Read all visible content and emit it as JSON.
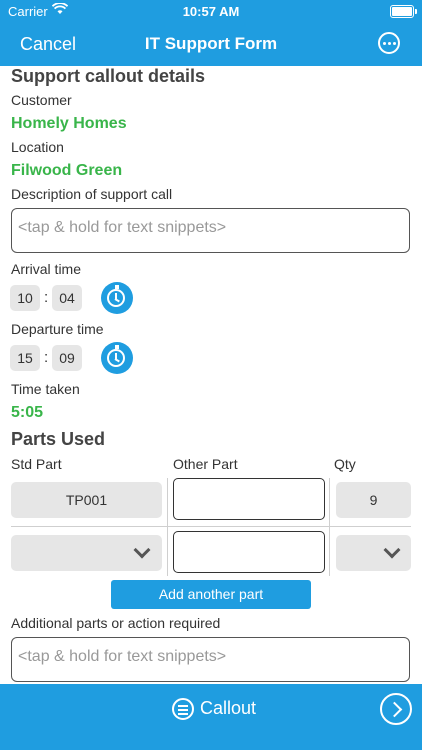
{
  "status_bar": {
    "carrier": "Carrier",
    "time": "10:57 AM"
  },
  "nav": {
    "cancel_label": "Cancel",
    "title": "IT Support Form",
    "more_icon": "more-circle-icon"
  },
  "callout_details": {
    "section_title": "Support callout details",
    "customer_label": "Customer",
    "customer_value": "Homely Homes",
    "location_label": "Location",
    "location_value": "Filwood Green",
    "description_label": "Description of support call",
    "description_placeholder": "<tap & hold for text snippets>"
  },
  "times": {
    "arrival_label": "Arrival time",
    "arrival_hour": "10",
    "arrival_minute": "04",
    "departure_label": "Departure time",
    "departure_hour": "15",
    "departure_minute": "09",
    "separator": ":",
    "taken_label": "Time taken",
    "taken_value": "5:05"
  },
  "parts": {
    "section_title": "Parts Used",
    "col_std": "Std Part",
    "col_other": "Other Part",
    "col_qty": "Qty",
    "rows": [
      {
        "std_part": "TP001",
        "other_part": "",
        "qty": "9"
      },
      {
        "std_part": "",
        "other_part": "",
        "qty": ""
      }
    ],
    "add_button": "Add another part"
  },
  "additional": {
    "label": "Additional parts or action required",
    "placeholder": "<tap & hold for text snippets>"
  },
  "bottom_bar": {
    "callout_label": "Callout"
  },
  "colors": {
    "accent": "#1f9de0",
    "green_value": "#39b54a",
    "field_grey": "#e6e6e6"
  }
}
